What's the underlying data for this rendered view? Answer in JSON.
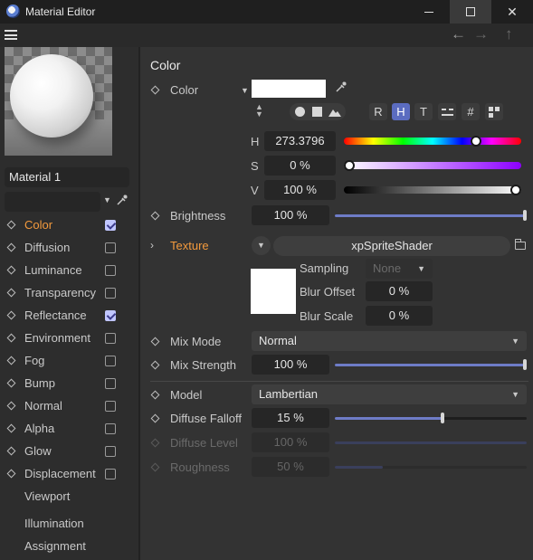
{
  "window": {
    "title": "Material Editor"
  },
  "left": {
    "material_name": "Material 1",
    "channels": [
      {
        "label": "Color",
        "checked": true,
        "active": true
      },
      {
        "label": "Diffusion",
        "checked": false,
        "active": false
      },
      {
        "label": "Luminance",
        "checked": false,
        "active": false
      },
      {
        "label": "Transparency",
        "checked": false,
        "active": false
      },
      {
        "label": "Reflectance",
        "checked": true,
        "active": false
      },
      {
        "label": "Environment",
        "checked": false,
        "active": false
      },
      {
        "label": "Fog",
        "checked": false,
        "active": false
      },
      {
        "label": "Bump",
        "checked": false,
        "active": false
      },
      {
        "label": "Normal",
        "checked": false,
        "active": false
      },
      {
        "label": "Alpha",
        "checked": false,
        "active": false
      },
      {
        "label": "Glow",
        "checked": false,
        "active": false
      },
      {
        "label": "Displacement",
        "checked": false,
        "active": false
      }
    ],
    "extra": [
      "Viewport",
      "Illumination",
      "Assignment"
    ]
  },
  "color_panel": {
    "section_title": "Color",
    "color_label": "Color",
    "color_value": "#ffffff",
    "mode_buttons": [
      "R",
      "H",
      "T",
      "#"
    ],
    "h_label": "H",
    "h_value": "273.3796",
    "h_fraction": 0.759,
    "s_label": "S",
    "s_value": "0 %",
    "s_fraction": 0.0,
    "v_label": "V",
    "v_value": "100 %",
    "v_fraction": 1.0,
    "brightness_label": "Brightness",
    "brightness_value": "100 %",
    "brightness_fraction": 1.0,
    "texture_label": "Texture",
    "texture_shader": "xpSpriteShader",
    "sampling_label": "Sampling",
    "sampling_value": "None",
    "blur_offset_label": "Blur Offset",
    "blur_offset_value": "0 %",
    "blur_scale_label": "Blur Scale",
    "blur_scale_value": "0 %",
    "mix_mode_label": "Mix Mode",
    "mix_mode_value": "Normal",
    "mix_strength_label": "Mix Strength",
    "mix_strength_value": "100 %",
    "mix_strength_fraction": 1.0,
    "model_label": "Model",
    "model_value": "Lambertian",
    "diffuse_falloff_label": "Diffuse Falloff",
    "diffuse_falloff_value": "15 %",
    "diffuse_falloff_fraction": 0.57,
    "diffuse_level_label": "Diffuse Level",
    "diffuse_level_value": "100 %",
    "diffuse_level_fraction": 1.0,
    "roughness_label": "Roughness",
    "roughness_value": "50 %",
    "roughness_fraction": 0.25
  },
  "colors": {
    "accent_orange": "#f39a3d",
    "slider_blue": "#6e7cc7",
    "selected_mode": "#5b6cc0"
  }
}
